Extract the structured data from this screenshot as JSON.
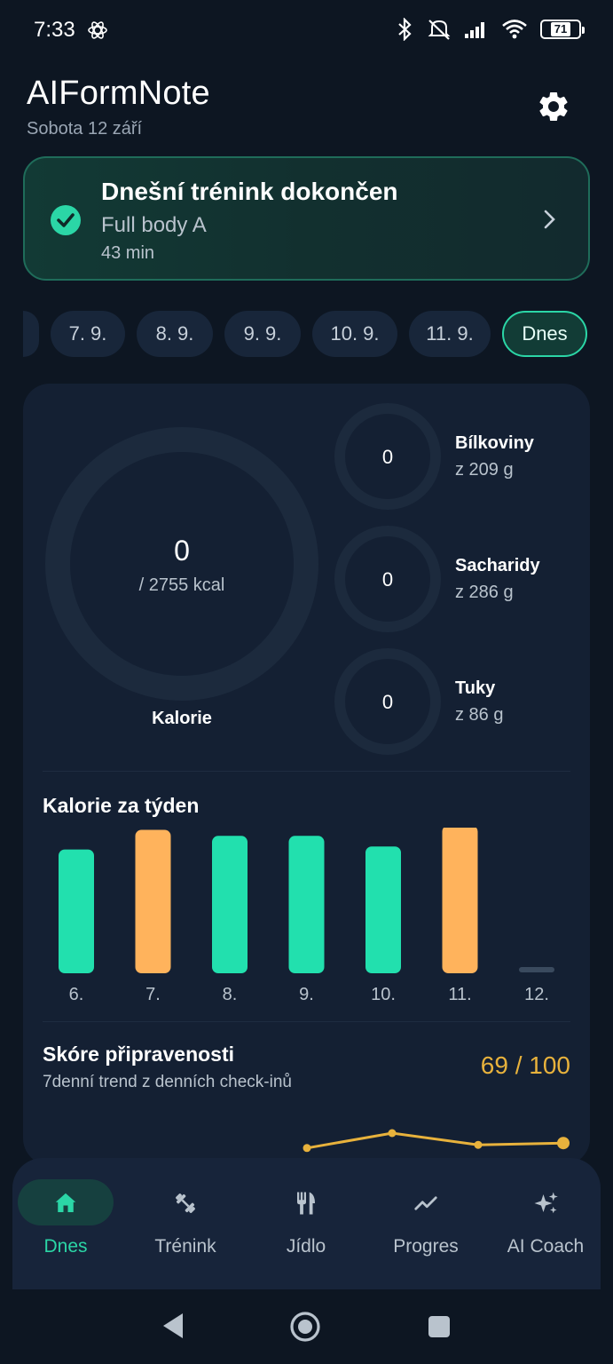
{
  "status": {
    "time": "7:33",
    "battery": "71"
  },
  "header": {
    "title": "AIFormNote",
    "date": "Sobota 12 září",
    "settings_icon": "gear-icon"
  },
  "workout": {
    "title": "Dnešní trénink dokončen",
    "name": "Full body A",
    "duration": "43 min",
    "accent": "#2bd6a6"
  },
  "days": [
    "7. 9.",
    "8. 9.",
    "9. 9.",
    "10. 9.",
    "11. 9.",
    "Dnes"
  ],
  "nutrition": {
    "calories": {
      "value": "0",
      "goal": "/ 2755 kcal",
      "label": "Kalorie"
    },
    "macros": [
      {
        "value": "0",
        "name": "Bílkoviny",
        "goal": "z 209 g"
      },
      {
        "value": "0",
        "name": "Sacharidy",
        "goal": "z 286 g"
      },
      {
        "value": "0",
        "name": "Tuky",
        "goal": "z 86 g"
      }
    ]
  },
  "week": {
    "title": "Kalorie za týden"
  },
  "readiness": {
    "title": "Skóre připravenosti",
    "subtitle": "7denní trend z denních check-inů",
    "score": "69 / 100"
  },
  "nav": [
    {
      "label": "Dnes",
      "icon": "home-icon"
    },
    {
      "label": "Trénink",
      "icon": "dumbbell-icon"
    },
    {
      "label": "Jídlo",
      "icon": "fork-knife-icon"
    },
    {
      "label": "Progres",
      "icon": "trend-icon"
    },
    {
      "label": "AI Coach",
      "icon": "sparkles-icon"
    }
  ],
  "chart_data": [
    {
      "type": "bar",
      "title": "Kalorie za týden",
      "categories": [
        "6.",
        "7.",
        "8.",
        "9.",
        "10.",
        "11.",
        "12."
      ],
      "values": [
        0.82,
        0.95,
        0.91,
        0.91,
        0.84,
        0.98,
        0.0
      ],
      "colors": [
        "#22e0ae",
        "#ffb35c",
        "#22e0ae",
        "#22e0ae",
        "#22e0ae",
        "#ffb35c",
        "#3a4a5e"
      ],
      "ylim": [
        0,
        1
      ]
    },
    {
      "type": "line",
      "title": "Skóre připravenosti",
      "values": [
        0.38,
        0.8,
        0.47,
        0.52
      ],
      "color": "#e8b23c",
      "ylim": [
        0,
        1
      ]
    }
  ]
}
